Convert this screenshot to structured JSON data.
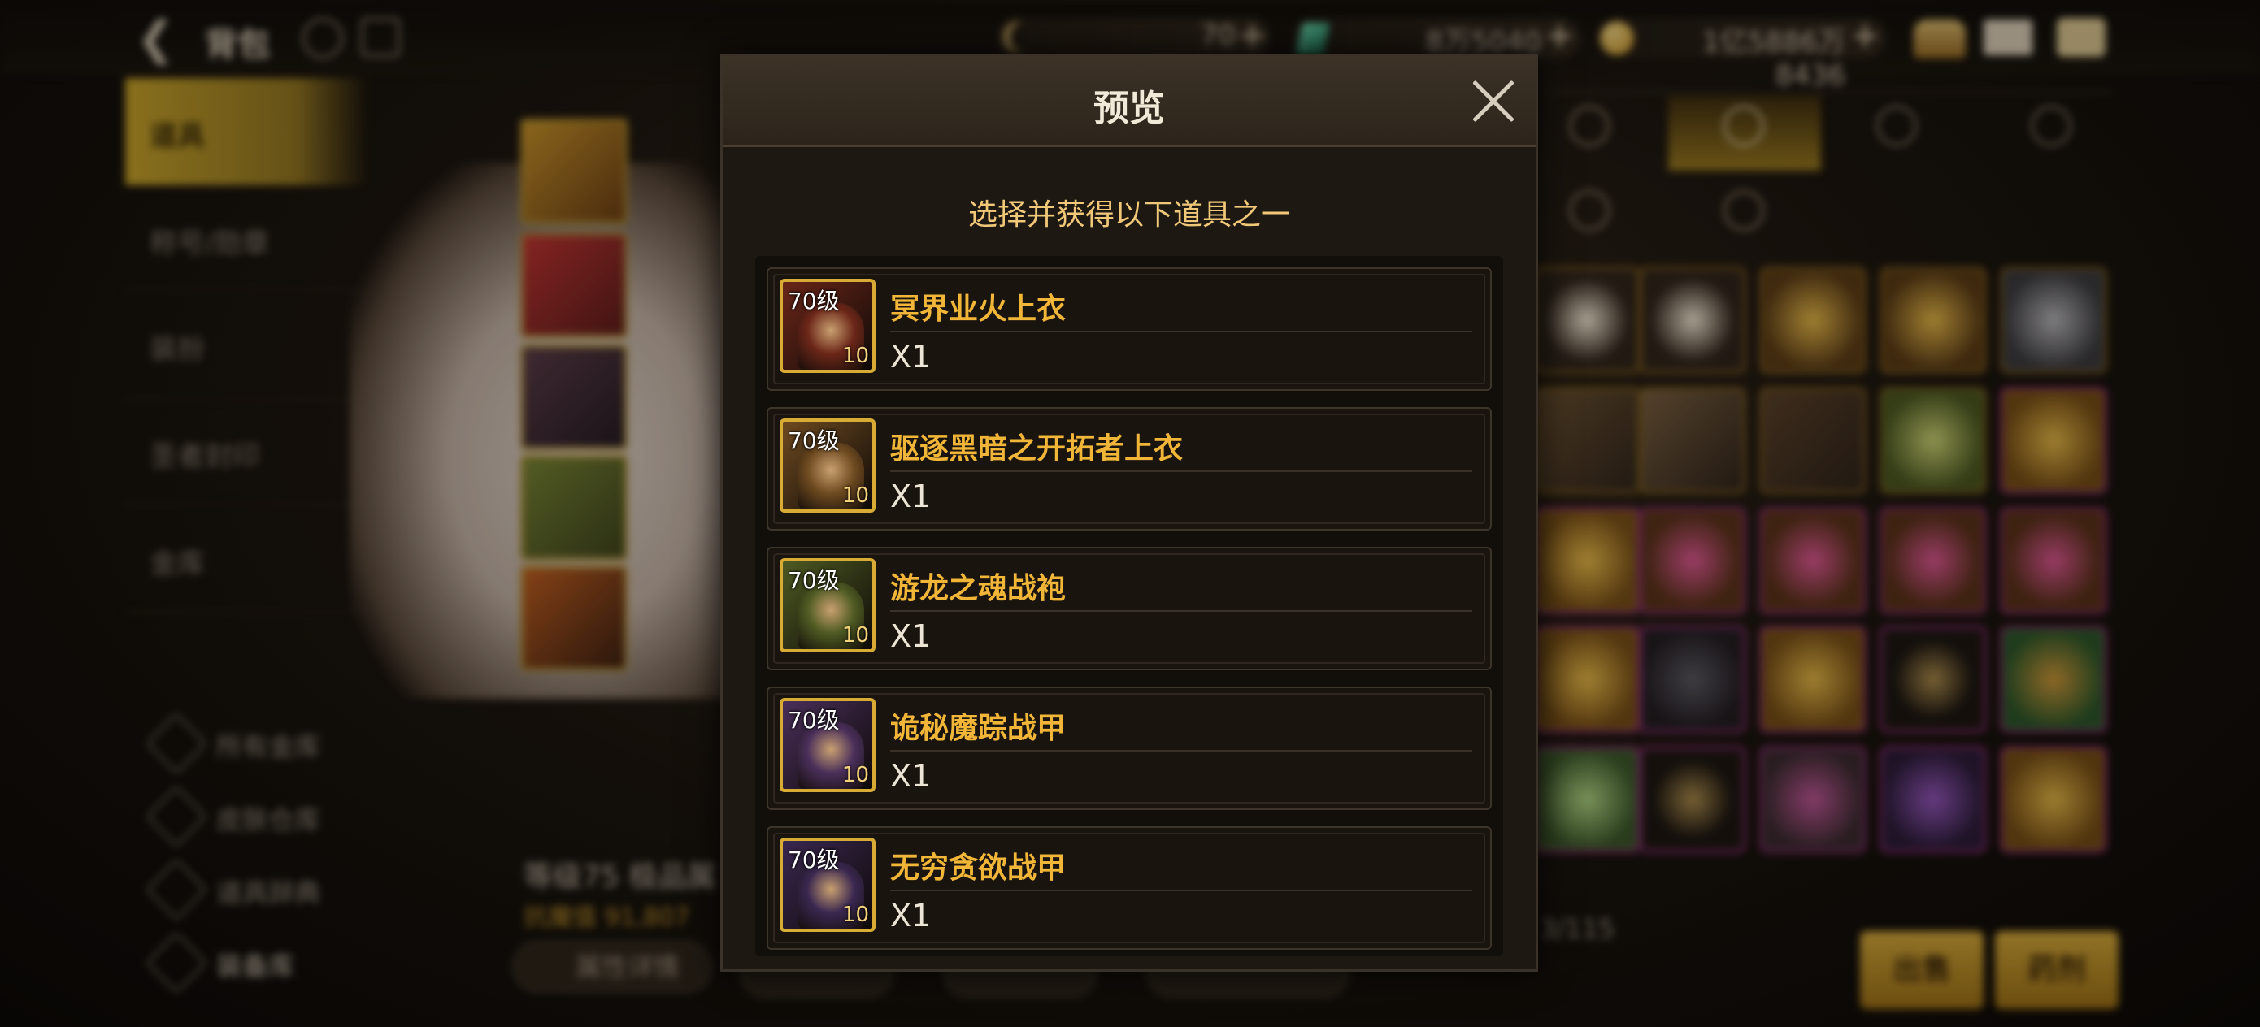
{
  "header": {
    "title": "背包"
  },
  "resources": [
    {
      "icon": "moon-icon",
      "value": "70"
    },
    {
      "icon": "gem-icon",
      "value": "8万5040"
    },
    {
      "icon": "gold-coin-icon",
      "value": "1亿5886万8436"
    }
  ],
  "sidebar": {
    "items": [
      {
        "label": "道具",
        "active": true
      },
      {
        "label": "称号/勋章"
      },
      {
        "label": "装扮"
      },
      {
        "label": "圣者封印"
      },
      {
        "label": "金库"
      }
    ],
    "sub_items": [
      {
        "label": "所有金库"
      },
      {
        "label": "皮肤仓库"
      },
      {
        "label": "道具辞典"
      },
      {
        "label": "装备库"
      }
    ]
  },
  "character": {
    "equip_title": "等级75 极品属",
    "equip_sub": "抗魔值 91,807",
    "buttons": [
      "属性详情"
    ]
  },
  "inventory": {
    "counter": "3/115"
  },
  "actions": {
    "sell": "出售",
    "craft": "药剂"
  },
  "modal": {
    "title": "预览",
    "subtitle": "选择并获得以下道具之一",
    "items": [
      {
        "level": "70级",
        "name": "冥界业火上衣",
        "quantity": "X1",
        "count": "10",
        "color": "#6b2618"
      },
      {
        "level": "70级",
        "name": "驱逐黑暗之开拓者上衣",
        "quantity": "X1",
        "count": "10",
        "color": "#6e4a20"
      },
      {
        "level": "70级",
        "name": "游龙之魂战袍",
        "quantity": "X1",
        "count": "10",
        "color": "#4e5a22"
      },
      {
        "level": "70级",
        "name": "诡秘魔踪战甲",
        "quantity": "X1",
        "count": "10",
        "color": "#4a2f5a"
      },
      {
        "level": "70级",
        "name": "无穷贪欲战甲",
        "quantity": "X1",
        "count": "10",
        "color": "#3a2750"
      }
    ]
  }
}
